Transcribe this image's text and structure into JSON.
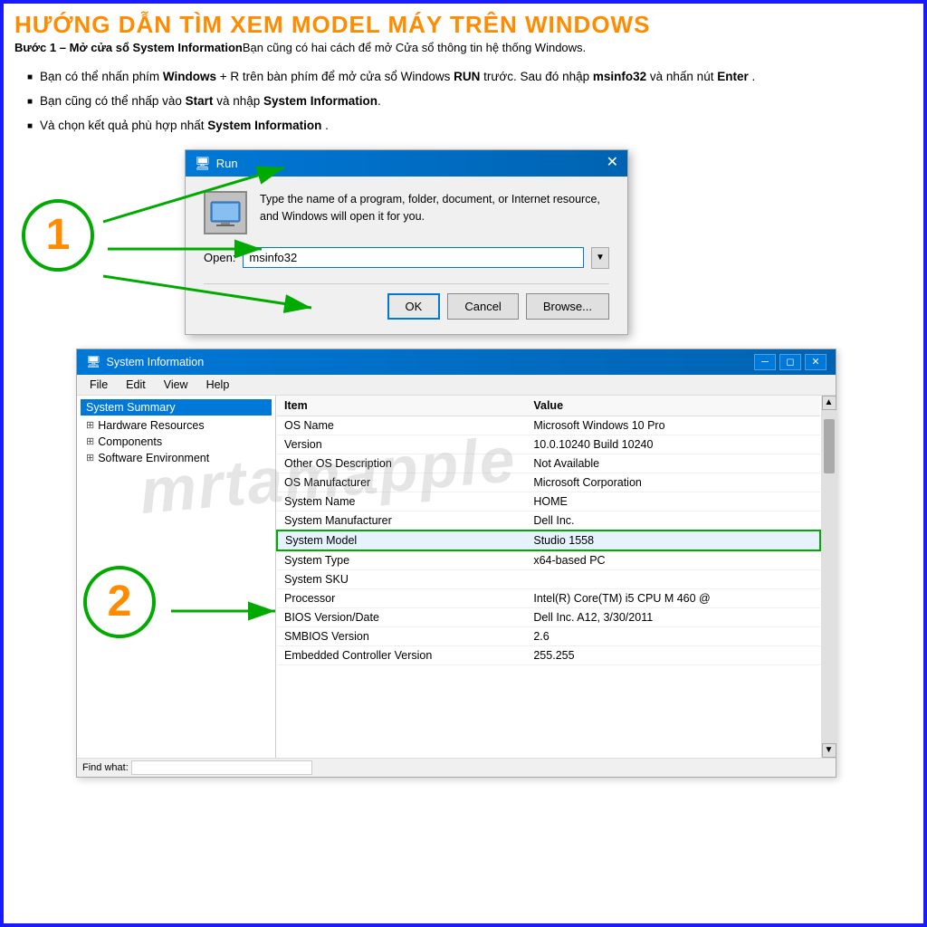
{
  "header": {
    "title": "HƯỚNG DẪN TÌM XEM MODEL MÁY TRÊN WINDOWS",
    "subtitle_bold": "Bước 1 – Mở cửa sổ System Information",
    "subtitle_rest": "Bạn cũng có hai cách để mở Cửa sổ thông tin hệ thống Windows."
  },
  "instructions": [
    {
      "text_normal": "Bạn có thể nhấn phím ",
      "text_bold1": "Windows",
      "text_normal2": " + R trên bàn phím để mở cửa sổ Windows ",
      "text_bold2": "RUN",
      "text_normal3": " trước. Sau đó nhập ",
      "text_bold3": "msinfo32",
      "text_normal4": " và nhấn nút ",
      "text_bold4": "Enter",
      "text_normal5": " ."
    },
    {
      "text_normal": "Bạn cũng có thể nhấp vào ",
      "text_bold1": "Start",
      "text_normal2": " và nhập ",
      "text_bold2": "System Information",
      "text_normal3": "."
    },
    {
      "text_normal": "Và chọn kết quả phù hợp nhất ",
      "text_bold1": "System Information",
      "text_normal2": " ."
    }
  ],
  "run_dialog": {
    "title": "Run",
    "description": "Type the name of a program, folder, document, or Internet resource, and Windows will open it for you.",
    "open_label": "Open:",
    "open_value": "msinfo32",
    "btn_ok": "OK",
    "btn_cancel": "Cancel",
    "btn_browse": "Browse..."
  },
  "sysinfo_window": {
    "title": "System Information",
    "menu": [
      "File",
      "Edit",
      "View",
      "Help"
    ],
    "left_panel": {
      "selected": "System Summary",
      "items": [
        {
          "label": "Hardware Resources",
          "has_expand": true
        },
        {
          "label": "Components",
          "has_expand": true
        },
        {
          "label": "Software Environment",
          "has_expand": true
        }
      ]
    },
    "right_panel": {
      "columns": [
        "Item",
        "Value"
      ],
      "rows": [
        {
          "item": "OS Name",
          "value": "Microsoft Windows 10 Pro",
          "highlighted": false
        },
        {
          "item": "Version",
          "value": "10.0.10240 Build 10240",
          "highlighted": false
        },
        {
          "item": "Other OS Description",
          "value": "Not Available",
          "highlighted": false
        },
        {
          "item": "OS Manufacturer",
          "value": "Microsoft Corporation",
          "highlighted": false
        },
        {
          "item": "System Name",
          "value": "HOME",
          "highlighted": false
        },
        {
          "item": "System Manufacturer",
          "value": "Dell Inc.",
          "highlighted": false
        },
        {
          "item": "System Model",
          "value": "Studio 1558",
          "highlighted": true
        },
        {
          "item": "System Type",
          "value": "x64-based PC",
          "highlighted": false
        },
        {
          "item": "System SKU",
          "value": "",
          "highlighted": false
        },
        {
          "item": "Processor",
          "value": "Intel(R) Core(TM) i5 CPU    M 460 @",
          "highlighted": false
        },
        {
          "item": "BIOS Version/Date",
          "value": "Dell Inc. A12, 3/30/2011",
          "highlighted": false
        },
        {
          "item": "SMBIOS Version",
          "value": "2.6",
          "highlighted": false
        },
        {
          "item": "Embedded Controller Version",
          "value": "255.255",
          "highlighted": false
        }
      ]
    }
  },
  "circle_1": "1",
  "circle_2": "2",
  "watermark": "mrtamapple"
}
